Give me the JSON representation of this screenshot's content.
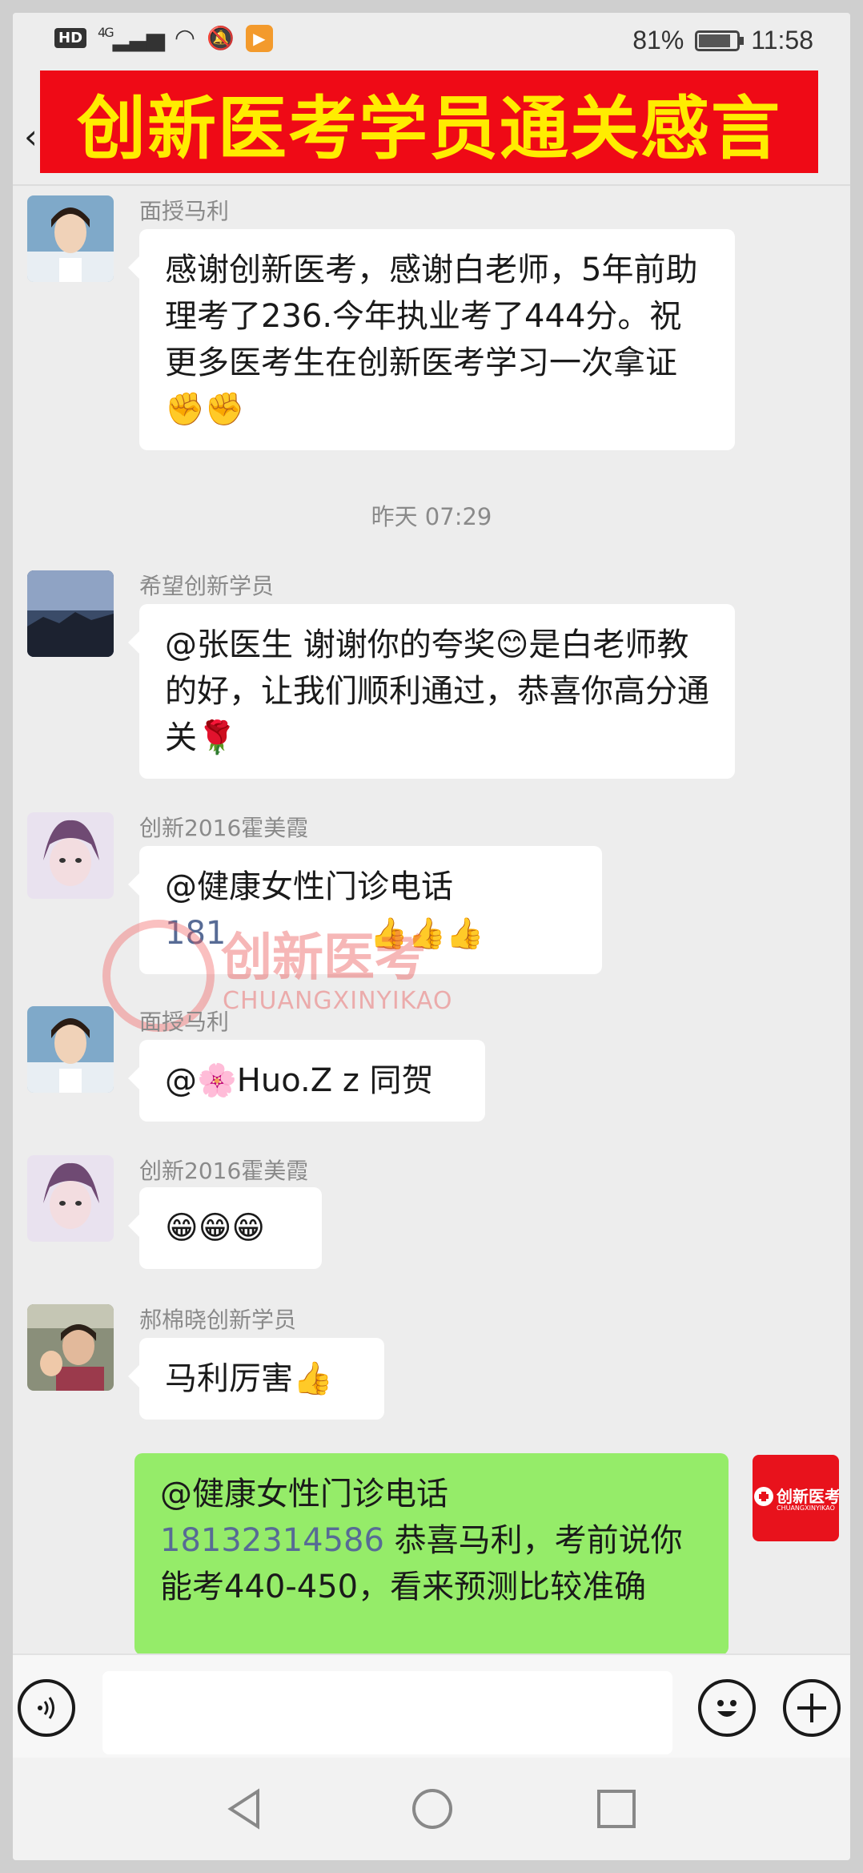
{
  "status_bar": {
    "hd": "HD",
    "network": "4G",
    "battery_percent": "81%",
    "battery_level": 0.81,
    "time": "11:58"
  },
  "header": {
    "banner_title": "创新医考学员通关感言"
  },
  "messages": [
    {
      "sender": "面授马利",
      "text": "感谢创新医考，感谢白老师，5年前助理考了236.今年执业考了444分。祝更多医考生在创新医考学习一次拿证✊✊"
    },
    {
      "timestamp": "昨天 07:29"
    },
    {
      "sender": "希望创新学员",
      "text": "@张医生  谢谢你的夸奖😊是白老师教的好，让我们顺利通过，恭喜你高分通关🌹"
    },
    {
      "sender": "创新2016霍美霞",
      "text_line1": "@健康女性门诊电话",
      "text_line2": "181",
      "text_line2_emoji": "👍👍👍"
    },
    {
      "sender": "面授马利",
      "text": "@🌸Huo.Z z  同贺"
    },
    {
      "sender": "创新2016霍美霞",
      "text": "😁😁😁"
    },
    {
      "sender": "郝棉晓创新学员",
      "text": "马利厉害👍"
    },
    {
      "sender": "me",
      "text_line1": "@健康女性门诊电话",
      "phone": "18132314586",
      "text_rest": " 恭喜马利，考前说你能考440-450，看来预测比较准确",
      "avatar_label": "创新医考",
      "avatar_sub": "CHUANGXINYIKAO"
    }
  ],
  "watermark": {
    "cn": "创新医考",
    "en": "CHUANGXINYIKAO"
  },
  "input_bar": {
    "voice_icon": "voice-icon",
    "emoji_icon": "emoji-icon",
    "plus_icon": "plus-icon"
  },
  "colors": {
    "banner_bg": "#ef0a16",
    "banner_text": "#ffec00",
    "my_bubble": "#95ec69",
    "phone_link": "#576b95"
  }
}
